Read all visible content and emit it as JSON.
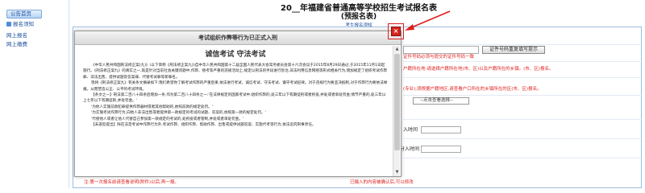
{
  "sidebar": {
    "tab_label": "公告首页",
    "items": [
      {
        "label": "报名须知"
      },
      {
        "label": "网上报名"
      },
      {
        "label": "网上缴费"
      }
    ]
  },
  "form": {
    "title": "20__年福建省普通高等学校招生考试报名表",
    "subtitle": "(预报名表)",
    "note": "考生报名须知",
    "cert_button": "证件号码重复填写提示",
    "red_note_cert": "证件号码必须与提交的证件号码一致",
    "red_note_address": "户籍所在地:请选择户籍所在地(市、区)以及户籍所在的乡镇。(市、区)报名。",
    "red_note_row2": "(专业),须根据户籍地区,请查看户口所在的乡镇所在的区(市、区)报名。",
    "select_placeholder": "--点击查看选择--",
    "label_time1": "入时间",
    "label_time2": "分入时间",
    "bottom_note_left": "注:第一次报名前请查看说明(附件)以后,再一报。",
    "bottom_note_right": "已输入的内容被确认后,可以修改"
  },
  "modal": {
    "header": "考试组织作弊等行为已正式入刑",
    "heading": "诚信考试 守法考试",
    "paragraphs": [
      "《中华人民共和国刑法修正案(九)》(以下简称《刑法修正案九》)自中华人民共和国第十二届全国人民代表大会常务委员会第十六次会议于2015年8月29日通过,于2015年11月1日起施行。《刑法修正案九》的真实之一,就是针对当前社会关键问题中,作弊、替考等严重的违规活动上,规定以刑法的手段进行惩治,非法利用信息网络等形式相关行为,增加规定了组织考试作弊罪、非法出售、提供试题及答案罪、代替考试罪等新罪名。",
      "现将《刑法修正案九》有关条文摘录如下:我们希望你了解考试作弊的严重后果,依法进行考试、诚信考试、守法考试、遵守考试纪律。对于违规行为要坚决抵制,对于作弊行为要依法举报。从而营造公正、公平的考试环境。",
      "【条文之一】刑法第二百八十四条后增加一条,作为第二百八十四条之一:'在法律规定的国家考试中,组织作弊的,处三年以下有期徒刑或者拘役,并处或者单处罚金;情节严重的,处三年以上七年以下有期徒刑,并处罚金。'",
      "'为他人实施前款犯罪提供作弊器材或者其他帮助的,依照前款的规定处罚。'",
      "'为实施考试作弊行为,向他人非法出售或者提供第一款规定的考试的试题、答案的,依照第一款的规定处罚。'",
      "'代替他人或者让他人代替自己参加第一款规定的考试的,处拘役或者管制,并处或者单处罚金。'",
      "【未遂犯提出】除在法定考试中作弊行为外,考试作弊、组织作弊、帮助作弊、出售或提供试题答案、实施代考等行为,依法追究刑事责任。"
    ]
  },
  "close_icon": "close-icon",
  "colors": {
    "accent": "#1a4f9c",
    "warning": "#e02020",
    "close": "#d8251c"
  }
}
